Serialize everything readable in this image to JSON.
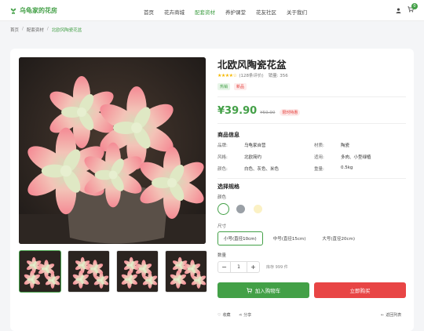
{
  "header": {
    "logo": "乌龟家的花房",
    "nav": [
      "首页",
      "花卉商城",
      "配套资材",
      "养护课堂",
      "花友社区",
      "关于我们"
    ],
    "active_index": 2,
    "cart_count": "0"
  },
  "breadcrumb": [
    "首页",
    "配套资材",
    "北欧风陶瓷花盆"
  ],
  "product": {
    "title": "北欧风陶瓷花盆",
    "rating_text": "(128条评价)",
    "sales_text": "销量: 356",
    "tags": [
      "热销",
      "新品"
    ],
    "price": "¥39.90",
    "old_price": "¥59.90",
    "promo": "限时特惠",
    "info_title": "商品信息",
    "specs": [
      {
        "k1": "品牌:",
        "v1": "乌龟家自营",
        "k2": "材质:",
        "v2": "陶瓷"
      },
      {
        "k1": "风格:",
        "v1": "北欧简约",
        "k2": "适用:",
        "v2": "多肉、小型绿植"
      },
      {
        "k1": "颜色:",
        "v1": "白色、灰色、米色",
        "k2": "重量:",
        "v2": "0.5kg"
      }
    ],
    "select_title": "选择规格",
    "color_label": "颜色",
    "colors": [
      "#ffffff",
      "#9aa0a6",
      "#fbf1c4"
    ],
    "size_label": "尺寸",
    "sizes": [
      "小号(直径10cm)",
      "中号(直径15cm)",
      "大号(直径20cm)"
    ],
    "qty_label": "数量",
    "qty": "1",
    "stock": "库存 999 件",
    "add_cart": "加入购物车",
    "buy_now": "立即购买",
    "favorite": "收藏",
    "share": "分享",
    "back": "返回列表"
  },
  "colors": {
    "accent": "#43a047",
    "danger": "#e84545"
  }
}
